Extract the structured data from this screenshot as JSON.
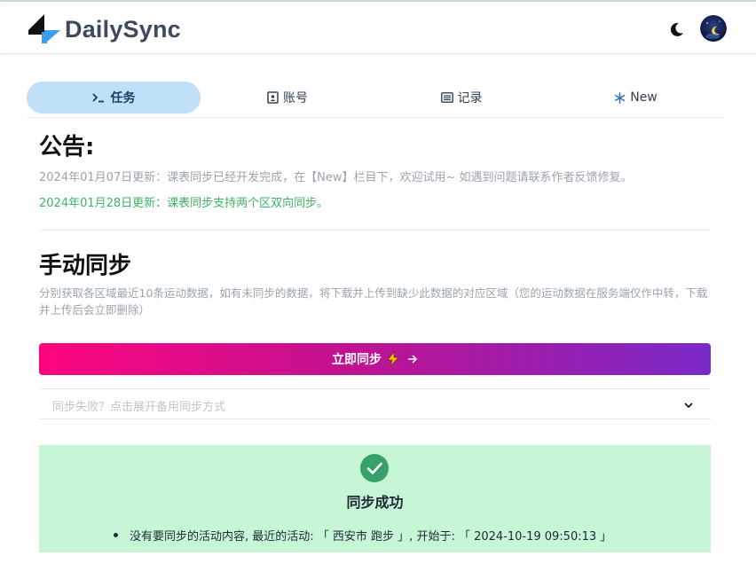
{
  "app": {
    "brand": "DailySync",
    "logo_icon": "dailysync-logo-icon",
    "theme_toggle_icon": "moon-icon",
    "avatar_icon": "user-avatar"
  },
  "tabs": [
    {
      "label": "任务",
      "icon": "terminal-icon",
      "active": true
    },
    {
      "label": "账号",
      "icon": "contact-card-icon",
      "active": false
    },
    {
      "label": "记录",
      "icon": "list-icon",
      "active": false
    },
    {
      "label": "New",
      "icon": "snowflake-icon",
      "active": false
    }
  ],
  "notice": {
    "title": "公告:",
    "items": [
      {
        "text": "2024年01月07日更新：课表同步已经开发完成，在【New】栏目下，欢迎试用~ 如遇到问题请联系作者反馈修复。",
        "color": "#9ca3af"
      },
      {
        "text": "2024年01月28日更新：课表同步支持两个区双向同步。",
        "color": "#3bb55f"
      }
    ]
  },
  "manual_sync": {
    "title": "手动同步",
    "description": "分别获取各区域最近10条运动数据，如有未同步的数据，将下载并上传到缺少此数据的对应区域（您的运动数据在服务端仅作中转，下载并上传后会立即删除）",
    "button_label": "立即同步",
    "button_icons": [
      "lightning-icon",
      "arrow-right-icon"
    ],
    "fallback_label": "同步失败？点击展开备用同步方式"
  },
  "result": {
    "title": "同步成功",
    "icon": "check-circle-icon",
    "messages": [
      "没有要同步的活动内容, 最近的活动: 「 西安市 跑步 」, 开始于: 「 2024-10-19 09:50:13 」"
    ]
  },
  "colors": {
    "accent_tab": "#bfe0f7",
    "button_gradient_start": "#ff0580",
    "button_gradient_end": "#7a2ac9",
    "success_bg": "#c6f6d5",
    "success_check": "#38a169"
  }
}
